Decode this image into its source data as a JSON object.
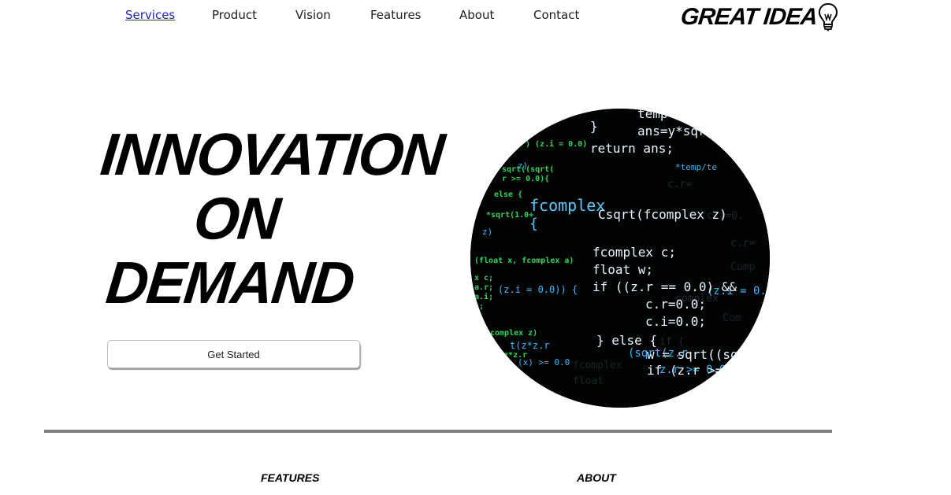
{
  "nav": {
    "items": [
      {
        "label": "Services",
        "active": true
      },
      {
        "label": "Product",
        "active": false
      },
      {
        "label": "Vision",
        "active": false
      },
      {
        "label": "Features",
        "active": false
      },
      {
        "label": "About",
        "active": false
      },
      {
        "label": "Contact",
        "active": false
      }
    ]
  },
  "logo": {
    "text": "GREAT IDEA",
    "icon": "lightbulb-icon"
  },
  "hero": {
    "title_lines": [
      "INNOVATION",
      "ON",
      "DEMAND"
    ],
    "cta_label": "Get Started",
    "image_icon": "code-screen-image"
  },
  "footer": {
    "features_heading": "FEATURES",
    "about_heading": "ABOUT"
  },
  "colors": {
    "nav_active": "#2222cc",
    "divider": "#808080",
    "code_bg": "#020403",
    "code_white": "#e8f4ff",
    "code_cyan": "#39b6ff",
    "code_green": "#2fd45a"
  }
}
